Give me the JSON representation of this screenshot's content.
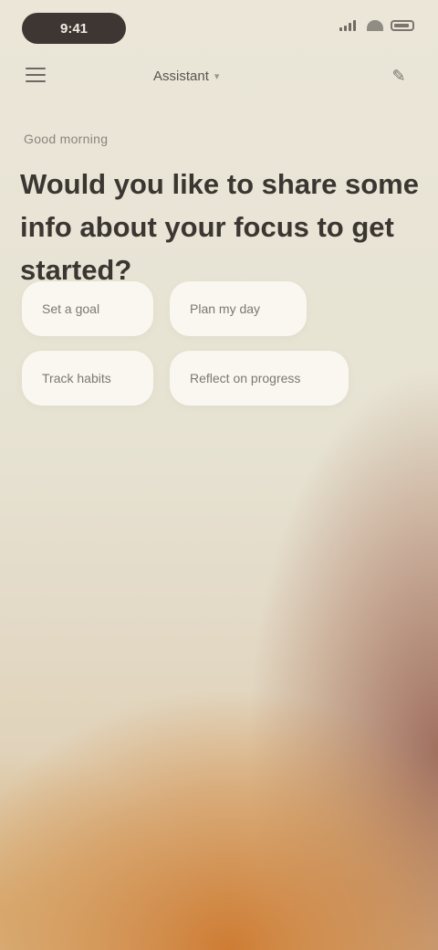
{
  "status_bar": {
    "time": "9:41"
  },
  "header": {
    "model_name": "Assistant",
    "menu_icon": "menu-icon",
    "new_chat_icon": "new-chat-icon"
  },
  "greeting": {
    "label": "Good morning",
    "headline": "Would you like to share some info about your focus to get started?"
  },
  "suggestions": [
    {
      "label": "Set a goal"
    },
    {
      "label": "Plan my day"
    },
    {
      "label": "Track habits"
    },
    {
      "label": "Reflect on progress"
    }
  ],
  "colors": {
    "accent_warm": "#cd782d",
    "text_dark": "#3b3631",
    "chip_bg": "#fbfaf4"
  }
}
